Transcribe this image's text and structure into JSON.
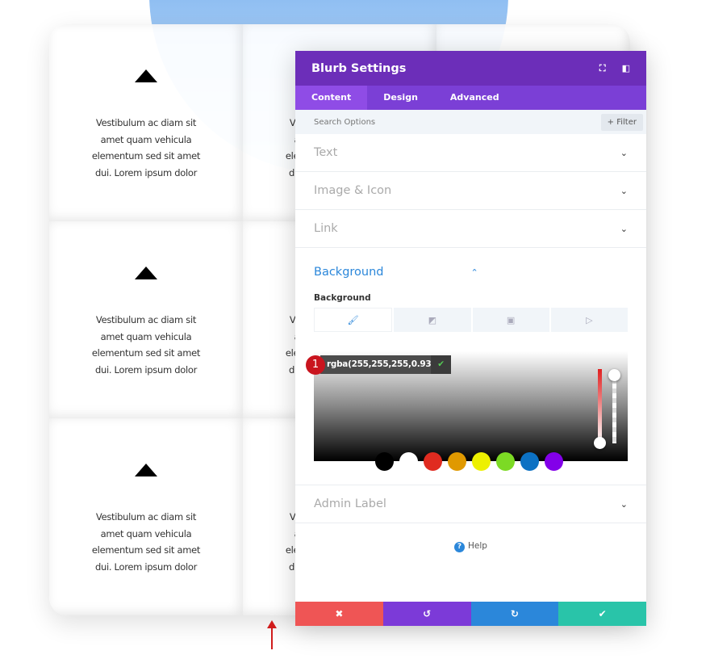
{
  "cards": [
    {
      "text": "Vestibulum ac diam sit amet quam vehicula elementum sed sit amet dui. Lorem ipsum dolor"
    }
  ],
  "panel": {
    "title": "Blurb Settings",
    "tabs": [
      {
        "label": "Content",
        "active": true
      },
      {
        "label": "Design"
      },
      {
        "label": "Advanced"
      }
    ],
    "search_placeholder": "Search Options",
    "filter_label": "+ Filter",
    "sections": [
      "Text",
      "Image & Icon",
      "Link"
    ],
    "background": {
      "title": "Background",
      "label": "Background",
      "color_value": "rgba(255,255,255,0.93)",
      "badge": "1",
      "swatches": [
        "#000000",
        "#ffffff",
        "#e02b20",
        "#e09900",
        "#edf000",
        "#7cda24",
        "#0c71c3",
        "#8300e9"
      ]
    },
    "admin_label": "Admin Label",
    "help": "Help",
    "footer_colors": [
      "#ef5555",
      "#7c3ad8",
      "#2b87da",
      "#29c4a9"
    ]
  }
}
